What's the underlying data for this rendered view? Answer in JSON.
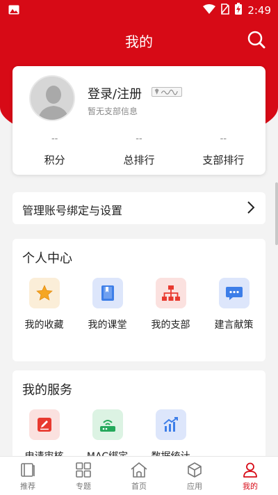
{
  "status_bar": {
    "time": "2:49"
  },
  "header": {
    "title": "我的"
  },
  "profile": {
    "login_label": "登录/注册",
    "branch_info": "暂无支部信息",
    "stats": [
      {
        "value": "--",
        "label": "积分"
      },
      {
        "value": "--",
        "label": "总排行"
      },
      {
        "value": "--",
        "label": "支部排行"
      }
    ]
  },
  "settings": {
    "label": "管理账号绑定与设置"
  },
  "personal_center": {
    "title": "个人中心",
    "items": [
      {
        "label": "我的收藏",
        "icon": "star-icon",
        "bg": "#fbeed8"
      },
      {
        "label": "我的课堂",
        "icon": "book-icon",
        "bg": "#dde6fb"
      },
      {
        "label": "我的支部",
        "icon": "org-chart-icon",
        "bg": "#fbe1df"
      },
      {
        "label": "建言献策",
        "icon": "chat-bubble-icon",
        "bg": "#dde6fb"
      }
    ]
  },
  "my_services": {
    "title": "我的服务",
    "items": [
      {
        "label": "申请审核",
        "icon": "edit-icon",
        "bg": "#fbe1df"
      },
      {
        "label": "MAC绑定",
        "icon": "router-icon",
        "bg": "#dcf3e3"
      },
      {
        "label": "数据统计",
        "icon": "chart-up-icon",
        "bg": "#dde6fb"
      }
    ]
  },
  "tabs": [
    {
      "label": "推荐",
      "icon": "book-open-icon"
    },
    {
      "label": "专题",
      "icon": "grid-icon"
    },
    {
      "label": "首页",
      "icon": "home-icon"
    },
    {
      "label": "应用",
      "icon": "cube-icon"
    },
    {
      "label": "我的",
      "icon": "person-icon"
    }
  ],
  "colors": {
    "brand_red": "#d70a16"
  }
}
